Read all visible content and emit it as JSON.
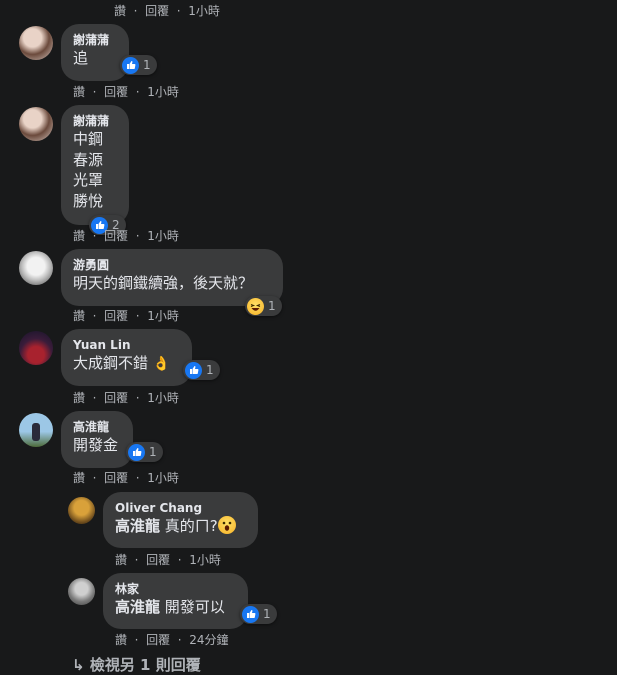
{
  "action_labels": {
    "like": "讚",
    "reply": "回覆",
    "sep": "·"
  },
  "comments": [
    {
      "time": "1小時"
    },
    {
      "author": "謝蒲蒲",
      "lines": [
        "追"
      ],
      "reaction_count": "1",
      "time": "1小時"
    },
    {
      "author": "謝蒲蒲",
      "lines": [
        "中鋼",
        "春源",
        "光罩",
        "勝悅"
      ],
      "reaction_count": "2",
      "time": "1小時"
    },
    {
      "author": "游勇圓",
      "lines": [
        "明天的鋼鐵續強，後天就？"
      ],
      "reaction_count": "1",
      "time": "1小時"
    },
    {
      "author": "Yuan Lin",
      "lines": [
        "大成鋼不錯"
      ],
      "emoji": "👌",
      "reaction_count": "1",
      "time": "1小時"
    },
    {
      "author": "高淮龍",
      "lines": [
        "開發金"
      ],
      "reaction_count": "1",
      "time": "1小時"
    },
    {
      "author": "Oliver Chang",
      "mention": "高淮龍",
      "text": "真的ㄇ?",
      "time": "1小時"
    },
    {
      "author": "林家",
      "mention": "高淮龍",
      "text": "開發可以",
      "reaction_count": "1",
      "time": "24分鐘"
    }
  ],
  "view_replies": "檢視另 1 則回覆",
  "colors": {
    "background": "#18191a",
    "bubble": "#3a3b3c",
    "like": "#1877f2",
    "muted": "#b0b3b8"
  }
}
